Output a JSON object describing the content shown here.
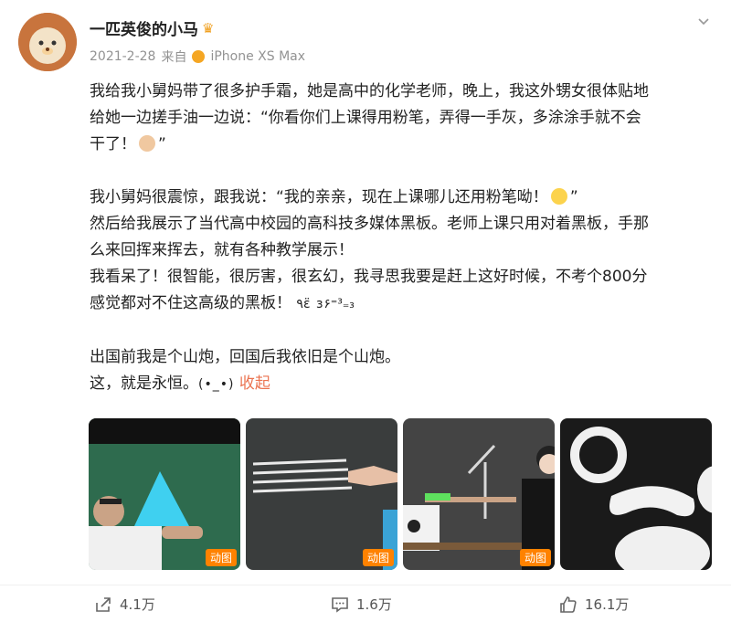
{
  "post": {
    "username": "一匹英俊的小马",
    "date": "2021-2-28",
    "via": "来自",
    "device": "iPhone XS Max",
    "paragraphs": [
      [
        "我给我小舅妈带了很多护手霜，她是高中的化学老师，晚上，我这外甥女很体贴地",
        "给她一边搓手油一边说：“你看你们上课得用粉笔，弄得一手灰，多涂涂手就不会",
        "干了！"
      ],
      [
        "我小舅妈很震惊，跟我说：“我的亲亲，现在上课哪儿还用粉笔呦！",
        "然后给我展示了当代高中校园的高科技多媒体黑板。老师上课只用对着黑板，手那",
        "么来回挥来挥去，就有各种教学展示！",
        "我看呆了！很智能，很厉害，很玄幻，我寻思我要是赶上这好时候，不考个800分",
        "感觉都对不住这高级的黑板！"
      ],
      [
        "出国前我是个山炮，回国后我依旧是个山炮。",
        "这，就是永恒。"
      ]
    ],
    "quote_close": "”",
    "kaomoji_1": "٩ε̈ ɜ۶⁼³₌₃",
    "kaomoji_2": "(•_•)",
    "collapse_label": "收起",
    "gif_badge": "动图",
    "images": [
      "teacher-triangle",
      "blackboard-lines",
      "teacher-pointing",
      "penguin-face"
    ]
  },
  "actions": {
    "share_count": "4.1万",
    "comment_count": "1.6万",
    "like_count": "16.1万"
  },
  "colors": {
    "accent": "#eb7350",
    "badge": "#ff8200",
    "meta": "#939393"
  }
}
